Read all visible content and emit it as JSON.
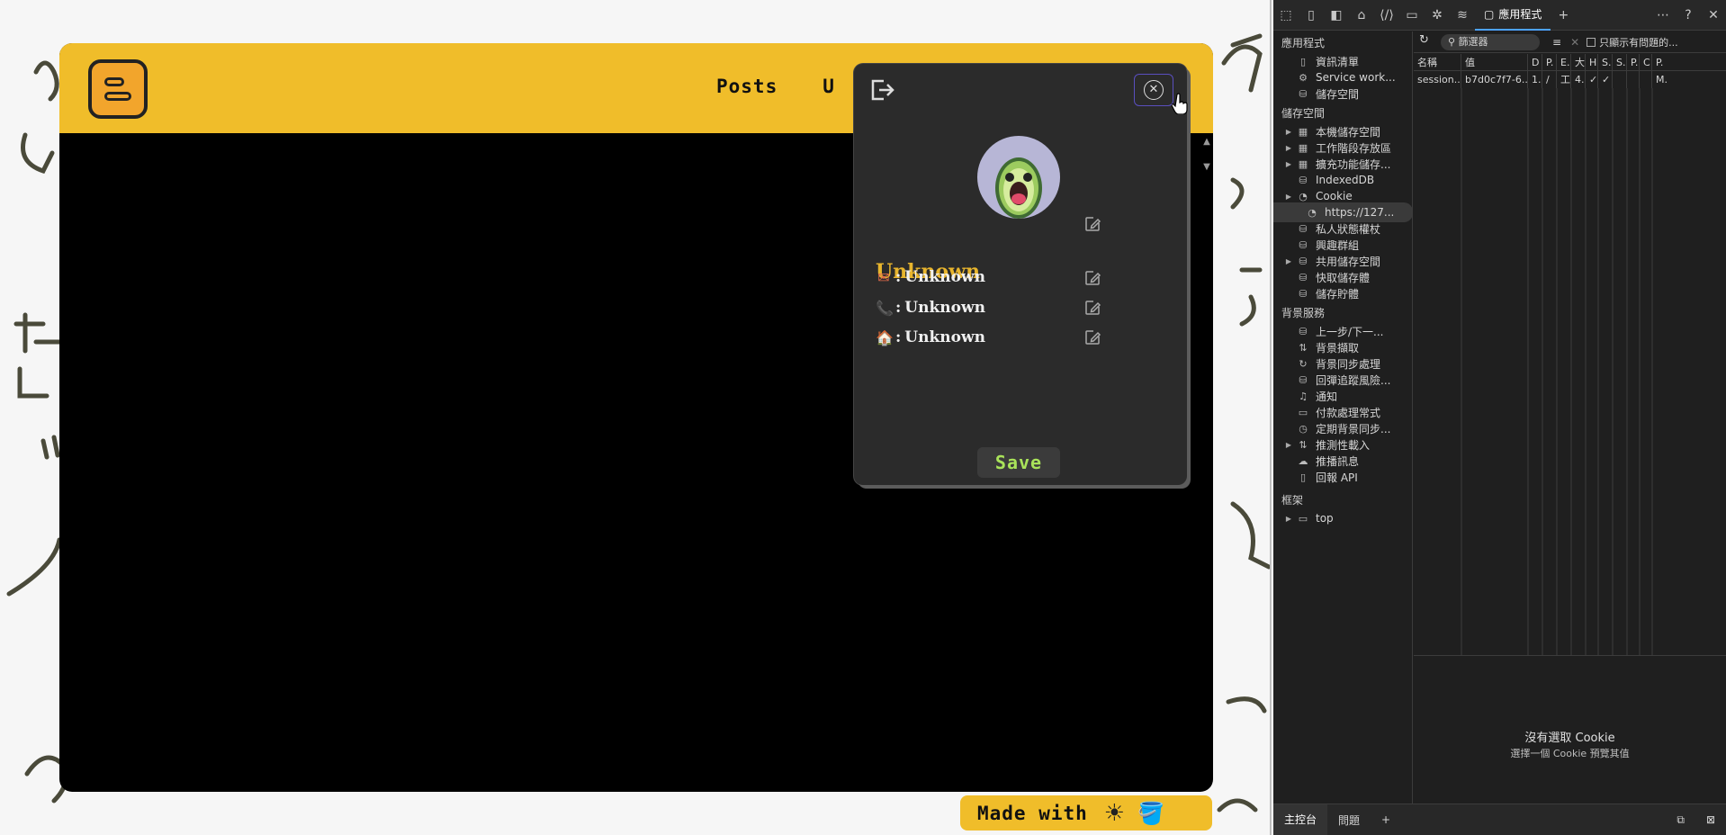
{
  "app": {
    "nav": [
      "Posts",
      "U"
    ],
    "footer_badge": {
      "label": "Made with",
      "icon1": "☀",
      "icon2": "🪣"
    }
  },
  "modal": {
    "name": "Unknown",
    "fields": [
      {
        "icon": "envelope-icon",
        "emoji": "✉",
        "value": "Unknown"
      },
      {
        "icon": "phone-icon",
        "emoji": "📞",
        "value": "Unknown"
      },
      {
        "icon": "house-icon",
        "emoji": "🏠",
        "value": "Unknown"
      }
    ],
    "save_label": "Save",
    "colors": {
      "name": "#e8b52d",
      "save": "#a9e35a",
      "bg": "#2b2b2b"
    }
  },
  "devtools": {
    "active_tab": "應用程式",
    "sections": {
      "application": "應用程式",
      "storage": "儲存空間",
      "background": "背景服務",
      "frames": "框架"
    },
    "application_items": [
      "資訊清單",
      "Service work...",
      "儲存空間"
    ],
    "storage_items": [
      "本機儲存空間",
      "工作階段存放區",
      "擴充功能儲存...",
      "IndexedDB",
      "Cookie",
      "https://127...",
      "私人狀態權杖",
      "興趣群組",
      "共用儲存空間",
      "快取儲存體",
      "儲存貯體"
    ],
    "background_items": [
      "上一步/下一...",
      "背景擷取",
      "背景同步處理",
      "回彈追蹤風險...",
      "通知",
      "付款處理常式",
      "定期背景同步...",
      "推測性載入",
      "推播訊息",
      "回報 API"
    ],
    "frames_items": [
      "top"
    ],
    "filter_placeholder": "篩選器",
    "only_issues_label": "只顯示有問題的...",
    "columns": [
      "名稱",
      "值",
      "D",
      "P.",
      "E.",
      "大",
      "H",
      "S.",
      "S.",
      "P.",
      "C",
      "P."
    ],
    "row": [
      "session...",
      "b7d0c7f7-6...",
      "1...",
      "/",
      "工",
      "4...",
      "✓",
      "✓",
      "",
      "",
      "",
      "M."
    ],
    "empty_title": "沒有選取 Cookie",
    "empty_sub": "選擇一個 Cookie 預覽其值",
    "bottom_tabs": [
      "主控台",
      "問題"
    ]
  }
}
